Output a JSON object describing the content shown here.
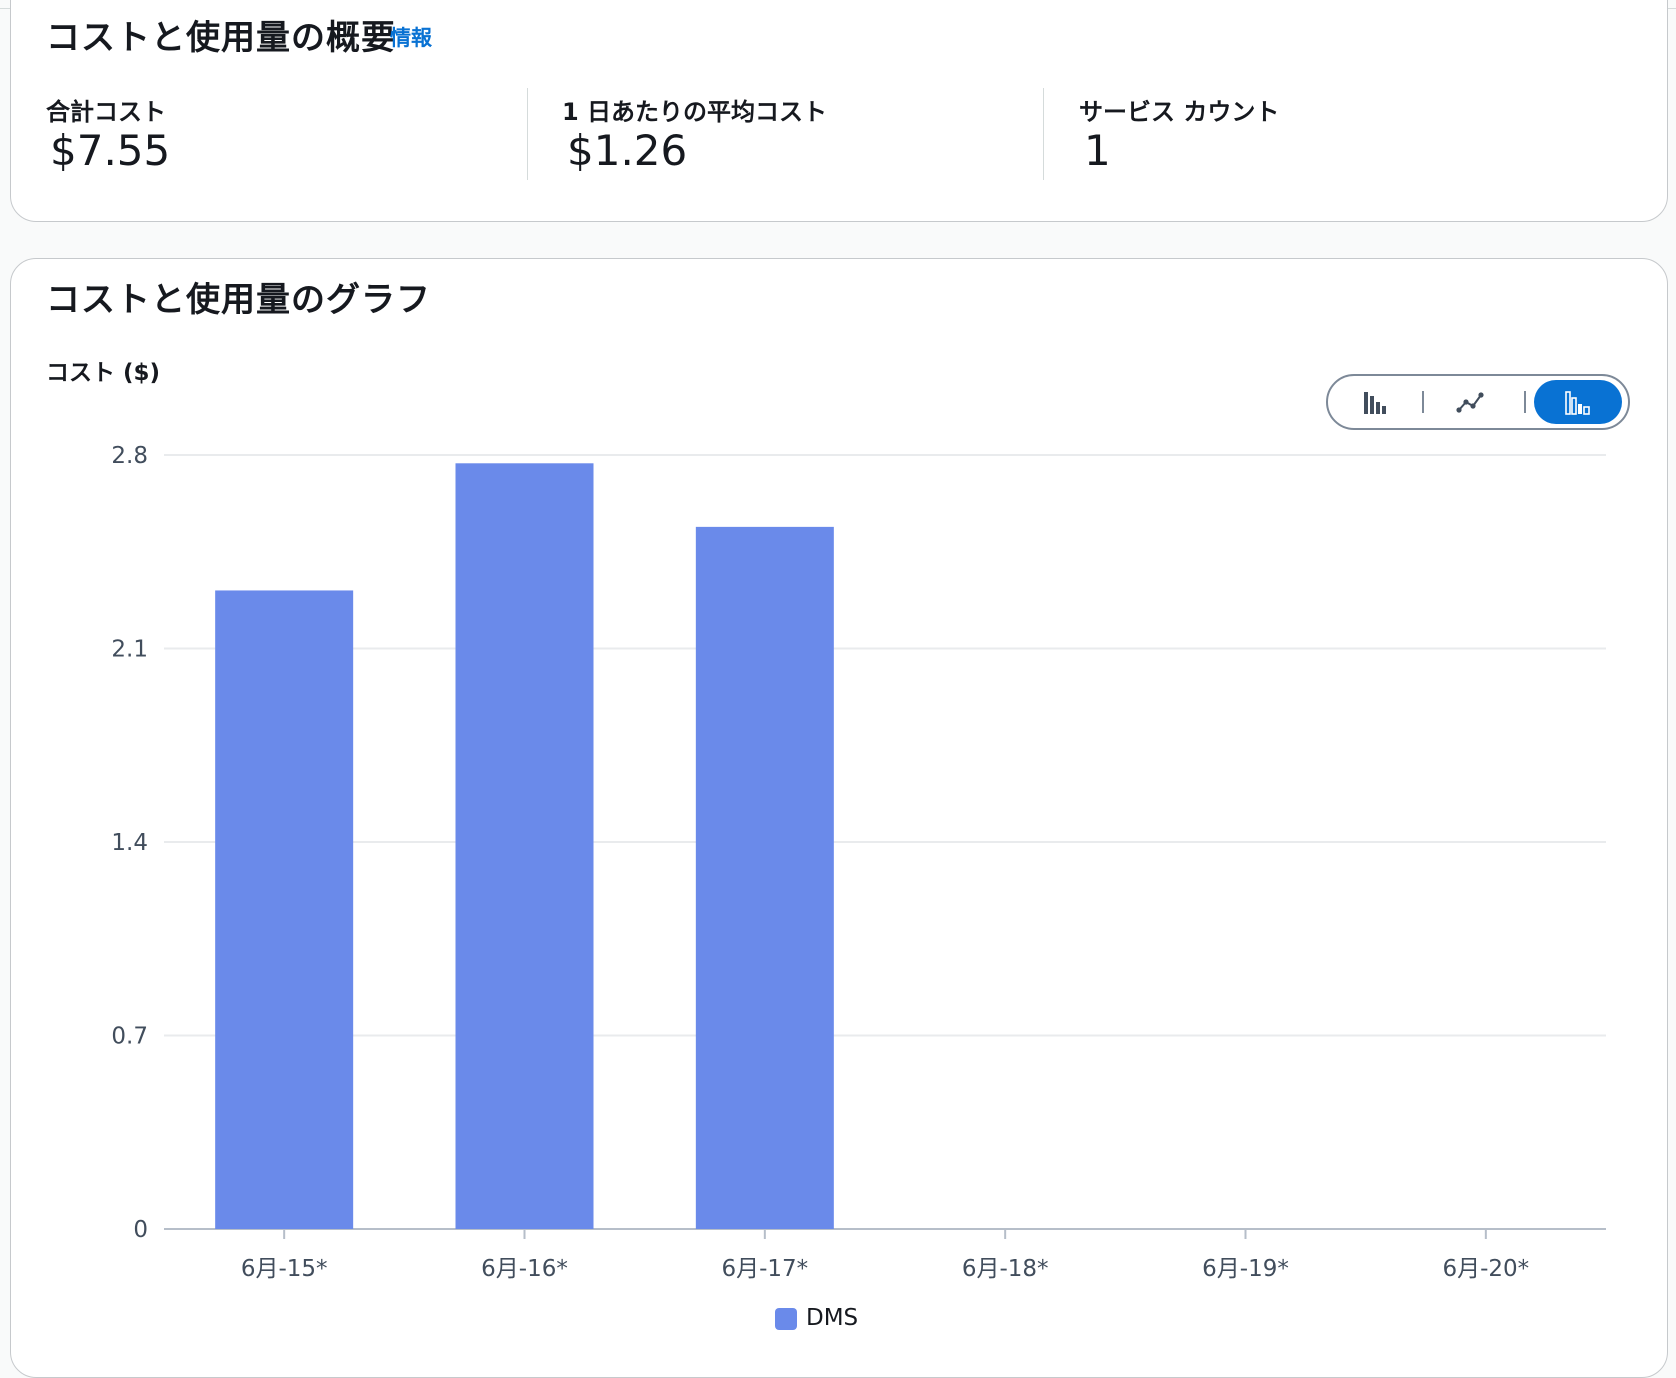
{
  "summary": {
    "title": "コストと使用量の概要",
    "info_link": "情報",
    "metrics": [
      {
        "label": "合計コスト",
        "value": "$7.55"
      },
      {
        "label": "1 日あたりの平均コスト",
        "value": "$1.26"
      },
      {
        "label": "サービス カウント",
        "value": "1"
      }
    ]
  },
  "chart_section": {
    "title": "コストと使用量のグラフ",
    "view_buttons": [
      {
        "icon": "grouped-bar-chart-icon",
        "active": false
      },
      {
        "icon": "line-chart-icon",
        "active": false
      },
      {
        "icon": "stacked-bar-chart-icon",
        "active": true
      }
    ]
  },
  "colors": {
    "bar": "#6a8aea",
    "accent": "#0972d3",
    "grid": "#e9ebed",
    "axis": "#b6bec9"
  },
  "chart_data": {
    "type": "bar",
    "ylabel": "コスト ($)",
    "xlabel": "",
    "categories": [
      "6月-15*",
      "6月-16*",
      "6月-17*",
      "6月-18*",
      "6月-19*",
      "6月-20*"
    ],
    "series": [
      {
        "name": "DMS",
        "values": [
          2.31,
          2.77,
          2.54,
          0,
          0,
          0
        ]
      }
    ],
    "ylim": [
      0,
      2.8
    ],
    "yticks": [
      0,
      0.7,
      1.4,
      2.1,
      2.8
    ],
    "ytick_labels": [
      "0",
      "0.7",
      "1.4",
      "2.1",
      "2.8"
    ],
    "grid": true,
    "legend_position": "bottom-center"
  }
}
